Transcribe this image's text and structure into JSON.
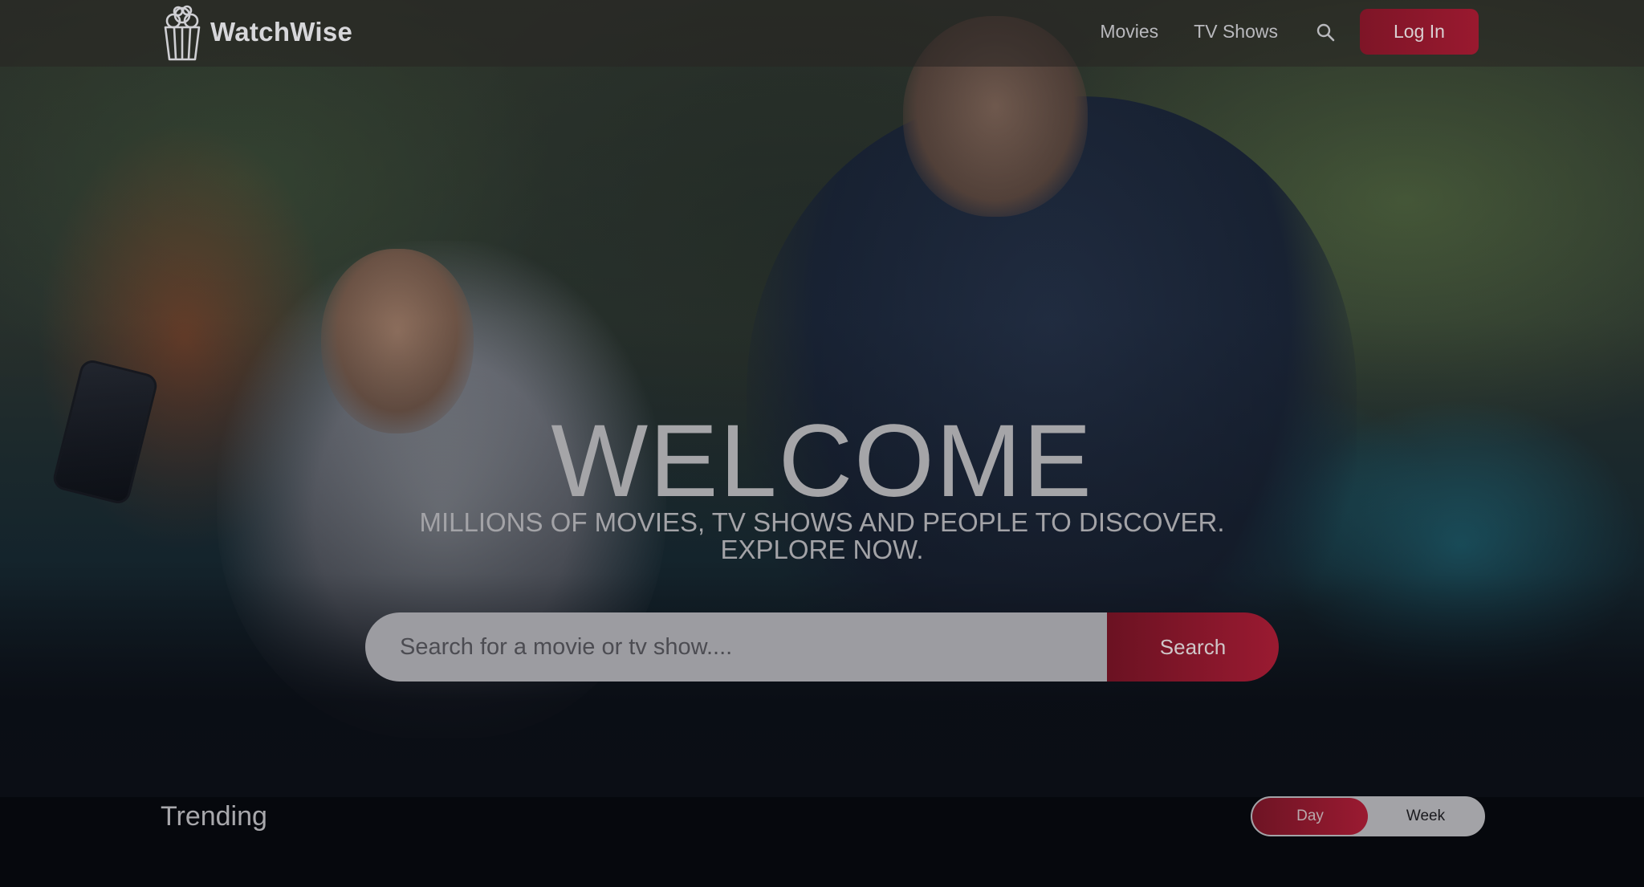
{
  "app": {
    "brand_name": "WatchWise",
    "logo_icon": "popcorn-icon"
  },
  "header": {
    "nav": {
      "movies": "Movies",
      "tv_shows": "TV Shows"
    },
    "search_icon": "search-icon",
    "login_label": "Log In"
  },
  "hero": {
    "title": "WELCOME",
    "subtitle": "MILLIONS OF MOVIES, TV SHOWS AND PEOPLE TO DISCOVER. EXPLORE NOW.",
    "search": {
      "placeholder": "Search for a movie or tv show....",
      "value": "",
      "button_label": "Search"
    }
  },
  "trending": {
    "title": "Trending",
    "toggle": {
      "options": [
        "Day",
        "Week"
      ],
      "selected": "Day"
    }
  },
  "colors": {
    "accent": "#9a1a31",
    "background": "#06080d",
    "text": "#a5a5a8"
  }
}
